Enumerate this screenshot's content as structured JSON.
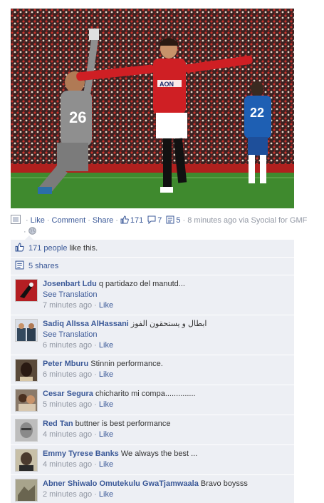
{
  "post": {
    "actions": {
      "like": "Like",
      "comment": "Comment",
      "share": "Share",
      "like_count": "171",
      "comment_count": "7",
      "share_count": "5",
      "time_source": "8 minutes ago via Syocial for GMF"
    }
  },
  "ufi": {
    "likes_link": "171 people",
    "likes_suffix": "like this.",
    "shares_link": "5 shares",
    "comments": [
      {
        "author": "Josenbart Ldu",
        "text": "q partidazo del manutd...",
        "translation": "See Translation",
        "time": "7 minutes ago",
        "like": "Like",
        "avatar_color": "#b41e23"
      },
      {
        "author": "Sadiq AlIssa AlHassani",
        "text": "ابطال و يستحقون الفوز",
        "translation": "See Translation",
        "time": "6 minutes ago",
        "like": "Like",
        "avatar_color": "#34495e"
      },
      {
        "author": "Peter Mburu",
        "text": "Stinnin performance.",
        "translation": "",
        "time": "6 minutes ago",
        "like": "Like",
        "avatar_color": "#3d2a1e"
      },
      {
        "author": "Cesar Segura",
        "text": "chicharito mi compa..............",
        "translation": "",
        "time": "5 minutes ago",
        "like": "Like",
        "avatar_color": "#6b5d4f"
      },
      {
        "author": "Red Tan",
        "text": "buttner is best performance",
        "translation": "",
        "time": "4 minutes ago",
        "like": "Like",
        "avatar_color": "#8a8a8a"
      },
      {
        "author": "Emmy Tyrese Banks",
        "text": "We always the best ...",
        "translation": "",
        "time": "4 minutes ago",
        "like": "Like",
        "avatar_color": "#4a3a2e"
      },
      {
        "author": "Abner Shiwalo Omutekulu GwaTjamwaala",
        "text": "Bravo boysss",
        "translation": "",
        "time": "2 minutes ago",
        "like": "Like",
        "avatar_color": "#7a7560"
      }
    ]
  }
}
